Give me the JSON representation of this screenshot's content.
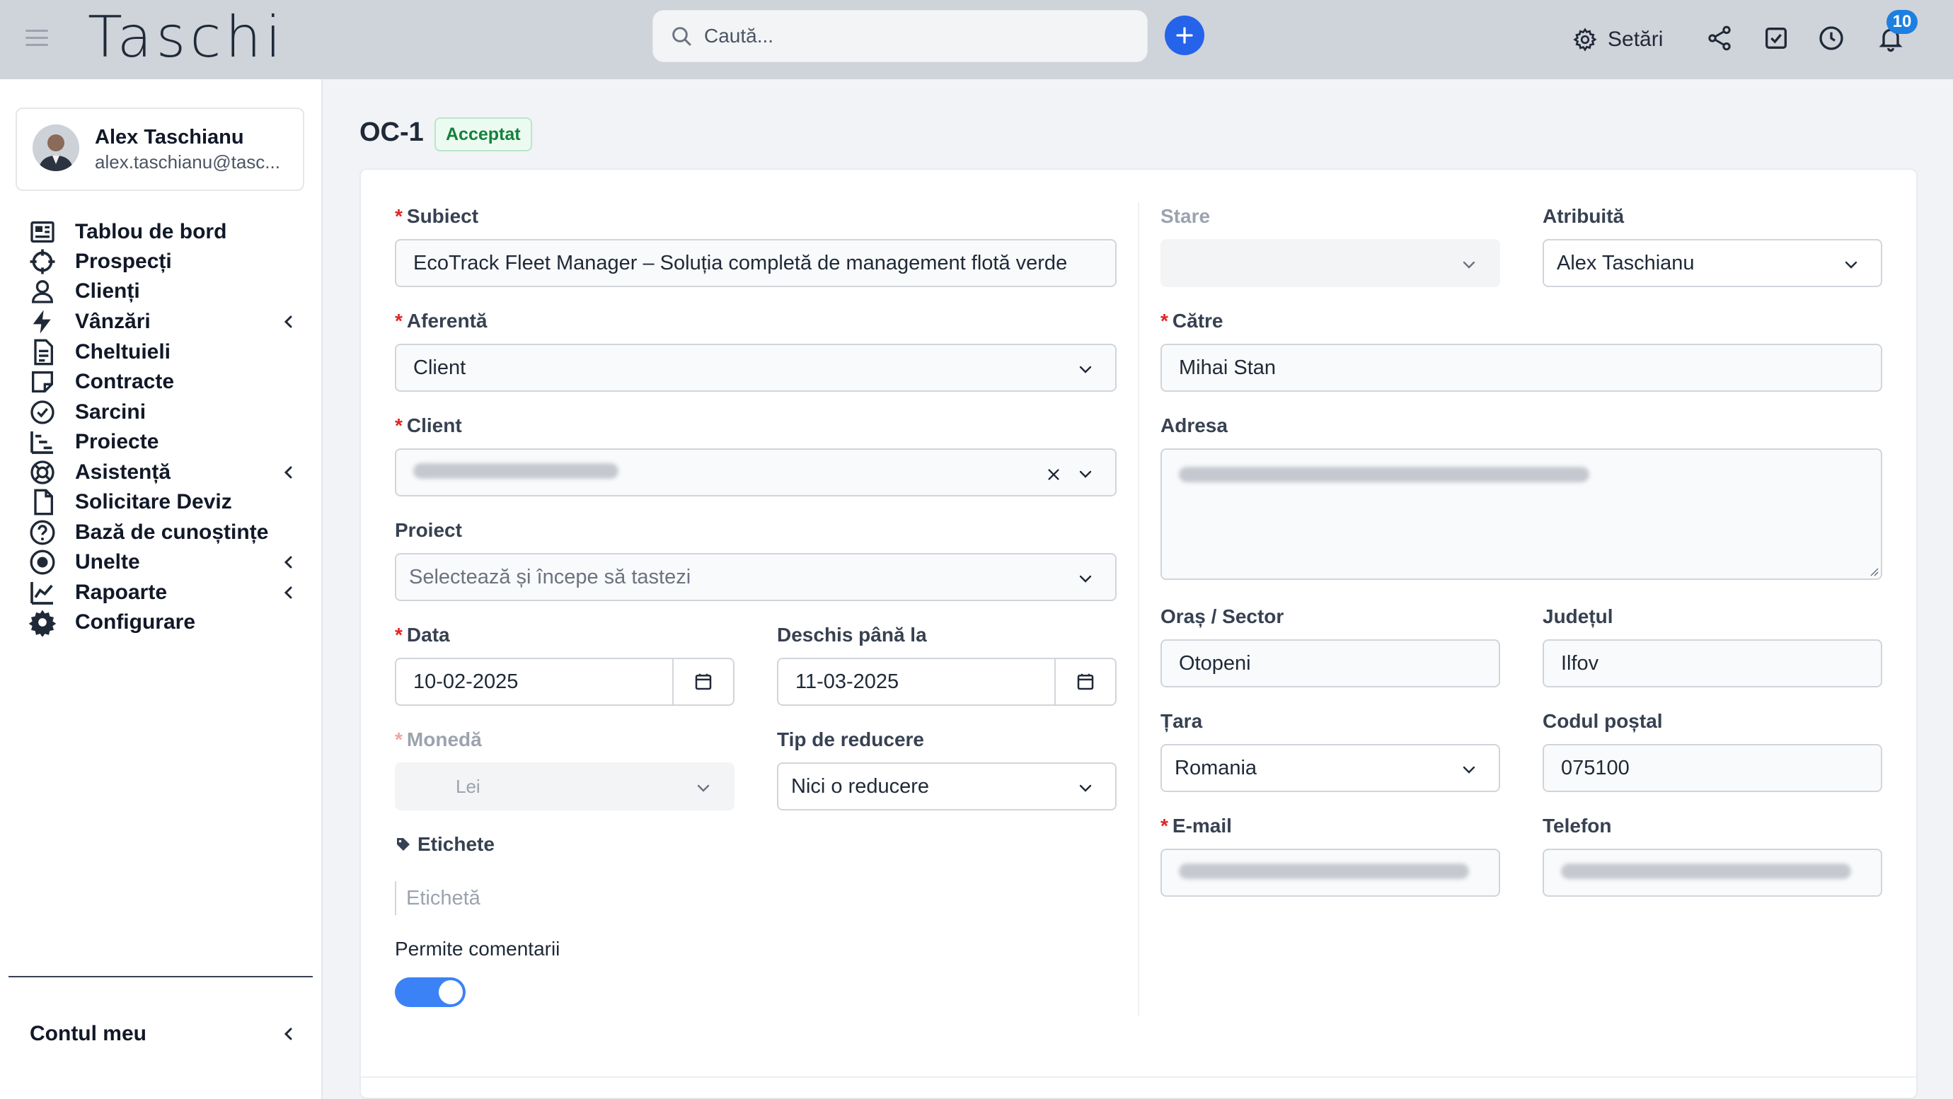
{
  "topbar": {
    "logo": "Taschi",
    "search_placeholder": "Caută...",
    "settings_label": "Setări",
    "notifications_count": "10",
    "accent_color": "#2563eb"
  },
  "sidebar": {
    "user": {
      "name": "Alex Taschianu",
      "email": "alex.taschianu@tasc..."
    },
    "items": [
      {
        "label": "Tablou de bord",
        "icon": "dashboard-icon",
        "has_submenu": false
      },
      {
        "label": "Prospecți",
        "icon": "crosshair-icon",
        "has_submenu": false
      },
      {
        "label": "Clienți",
        "icon": "user-icon",
        "has_submenu": false
      },
      {
        "label": "Vânzări",
        "icon": "bolt-icon",
        "has_submenu": true
      },
      {
        "label": "Cheltuieli",
        "icon": "file-text-icon",
        "has_submenu": false
      },
      {
        "label": "Contracte",
        "icon": "sticky-note-icon",
        "has_submenu": false
      },
      {
        "label": "Sarcini",
        "icon": "check-circle-icon",
        "has_submenu": false
      },
      {
        "label": "Proiecte",
        "icon": "gantt-icon",
        "has_submenu": false
      },
      {
        "label": "Asistență",
        "icon": "lifebuoy-icon",
        "has_submenu": true
      },
      {
        "label": "Solicitare Deviz",
        "icon": "file-icon",
        "has_submenu": false
      },
      {
        "label": "Bază de cunoștințe",
        "icon": "question-circle-icon",
        "has_submenu": false
      },
      {
        "label": "Unelte",
        "icon": "dot-circle-icon",
        "has_submenu": true
      },
      {
        "label": "Rapoarte",
        "icon": "line-chart-icon",
        "has_submenu": true
      },
      {
        "label": "Configurare",
        "icon": "cog-icon",
        "has_submenu": false
      }
    ],
    "account_label": "Contul meu"
  },
  "page": {
    "title": "OC-1",
    "status": "Acceptat"
  },
  "form": {
    "subject": {
      "label": "Subiect",
      "value": "EcoTrack Fleet Manager – Soluția completă de management flotă verde"
    },
    "related": {
      "label": "Aferentă",
      "value": "Client"
    },
    "client": {
      "label": "Client"
    },
    "project": {
      "label": "Proiect",
      "placeholder": "Selectează și începe să tastezi"
    },
    "date": {
      "label": "Data",
      "value": "10-02-2025"
    },
    "open_till": {
      "label": "Deschis până la",
      "value": "11-03-2025"
    },
    "currency": {
      "label": "Monedă",
      "value": "Lei"
    },
    "discount_type": {
      "label": "Tip de reducere",
      "value": "Nici o reducere"
    },
    "tags": {
      "label": "Etichete",
      "placeholder": "Etichetă"
    },
    "allow_comments": {
      "label": "Permite comentarii",
      "enabled": true
    },
    "status": {
      "label": "Stare",
      "value": ""
    },
    "assigned": {
      "label": "Atribuită",
      "value": "Alex Taschianu"
    },
    "to": {
      "label": "Către",
      "value": "Mihai Stan"
    },
    "address": {
      "label": "Adresa"
    },
    "city": {
      "label": "Oraș / Sector",
      "value": "Otopeni"
    },
    "state": {
      "label": "Județul",
      "value": "Ilfov"
    },
    "country": {
      "label": "Țara",
      "value": "Romania"
    },
    "zip": {
      "label": "Codul poștal",
      "value": "075100"
    },
    "email": {
      "label": "E-mail"
    },
    "phone": {
      "label": "Telefon"
    }
  }
}
